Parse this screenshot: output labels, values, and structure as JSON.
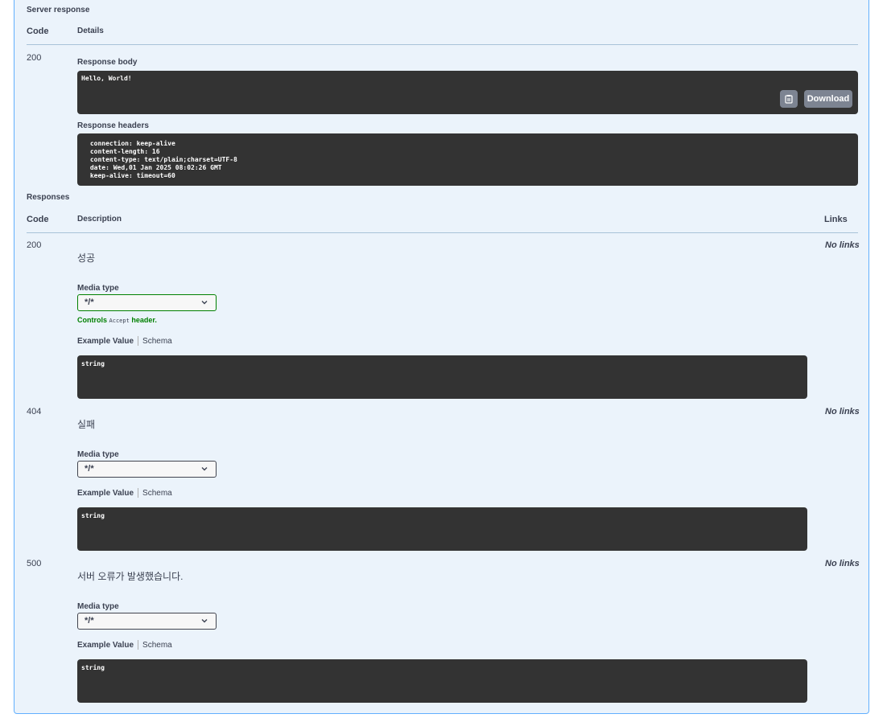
{
  "server_response": {
    "title": "Server response",
    "col_code": "Code",
    "col_details": "Details",
    "code": "200",
    "body_title": "Response body",
    "body": "Hello, World!",
    "download_label": "Download",
    "headers_title": "Response headers",
    "headers": [
      " connection: keep-alive ",
      " content-length: 16 ",
      " content-type: text/plain;charset=UTF-8 ",
      " date: Wed,01 Jan 2025 08:02:26 GMT ",
      " keep-alive: timeout=60 "
    ]
  },
  "responses": {
    "title": "Responses",
    "col_code": "Code",
    "col_description": "Description",
    "col_links": "Links",
    "media_type_label": "Media type",
    "controls_prefix": "Controls",
    "controls_code": "Accept",
    "controls_suffix": "header.",
    "example_value_tab": "Example Value",
    "schema_tab": "Schema",
    "items": [
      {
        "code": "200",
        "description": "성공",
        "media_type": "*/*",
        "example": "string",
        "links": "No links"
      },
      {
        "code": "404",
        "description": "실패",
        "media_type": "*/*",
        "example": "string",
        "links": "No links"
      },
      {
        "code": "500",
        "description": "서버 오류가 발생했습니다.",
        "media_type": "*/*",
        "example": "string",
        "links": "No links"
      }
    ]
  },
  "colors": {
    "panel_bg": "#ebf3fb",
    "panel_border": "#61affe",
    "code_bg": "#333333",
    "button_bg": "#7d8492",
    "active_select": "#008000"
  }
}
